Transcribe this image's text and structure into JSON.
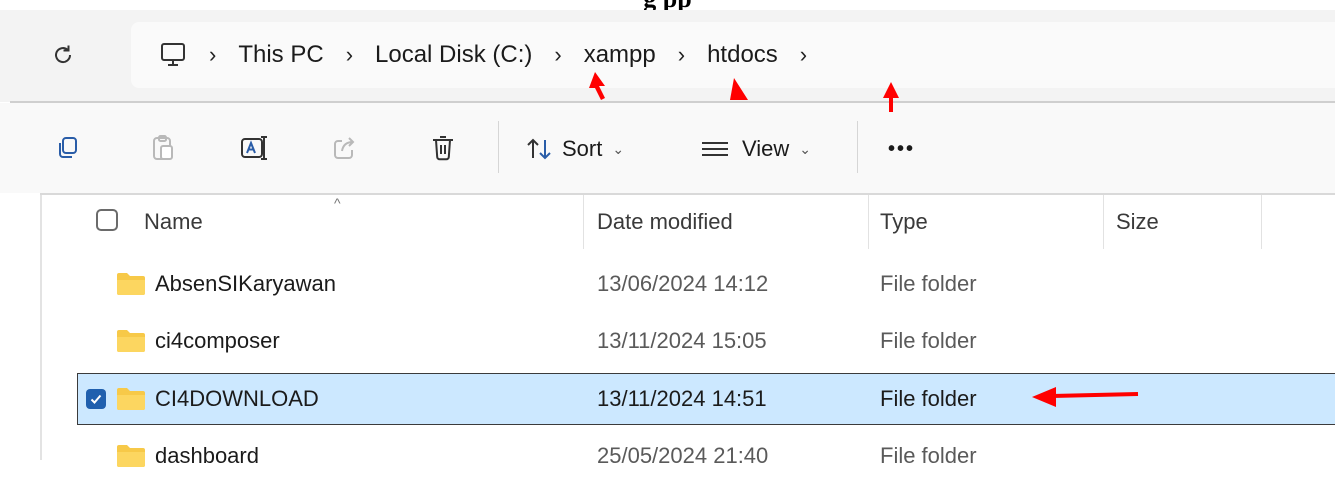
{
  "caption": "g       pp",
  "address_bar": {
    "crumbs": [
      "This PC",
      "Local Disk (C:)",
      "xampp",
      "htdocs"
    ]
  },
  "toolbar": {
    "sort_label": "Sort",
    "view_label": "View",
    "more_label": "•••"
  },
  "file_list": {
    "columns": {
      "name": "Name",
      "date": "Date modified",
      "type": "Type",
      "size": "Size"
    },
    "rows": [
      {
        "name": "AbsenSIKaryawan",
        "date": "13/06/2024 14:12",
        "type": "File folder",
        "selected": false
      },
      {
        "name": "ci4composer",
        "date": "13/11/2024 15:05",
        "type": "File folder",
        "selected": false
      },
      {
        "name": "CI4DOWNLOAD",
        "date": "13/11/2024 14:51",
        "type": "File folder",
        "selected": true
      },
      {
        "name": "dashboard",
        "date": "25/05/2024 21:40",
        "type": "File folder",
        "selected": false
      }
    ]
  },
  "colors": {
    "annotation": "#ff0000",
    "selection": "#cce8ff",
    "folder": "#f7c948"
  }
}
